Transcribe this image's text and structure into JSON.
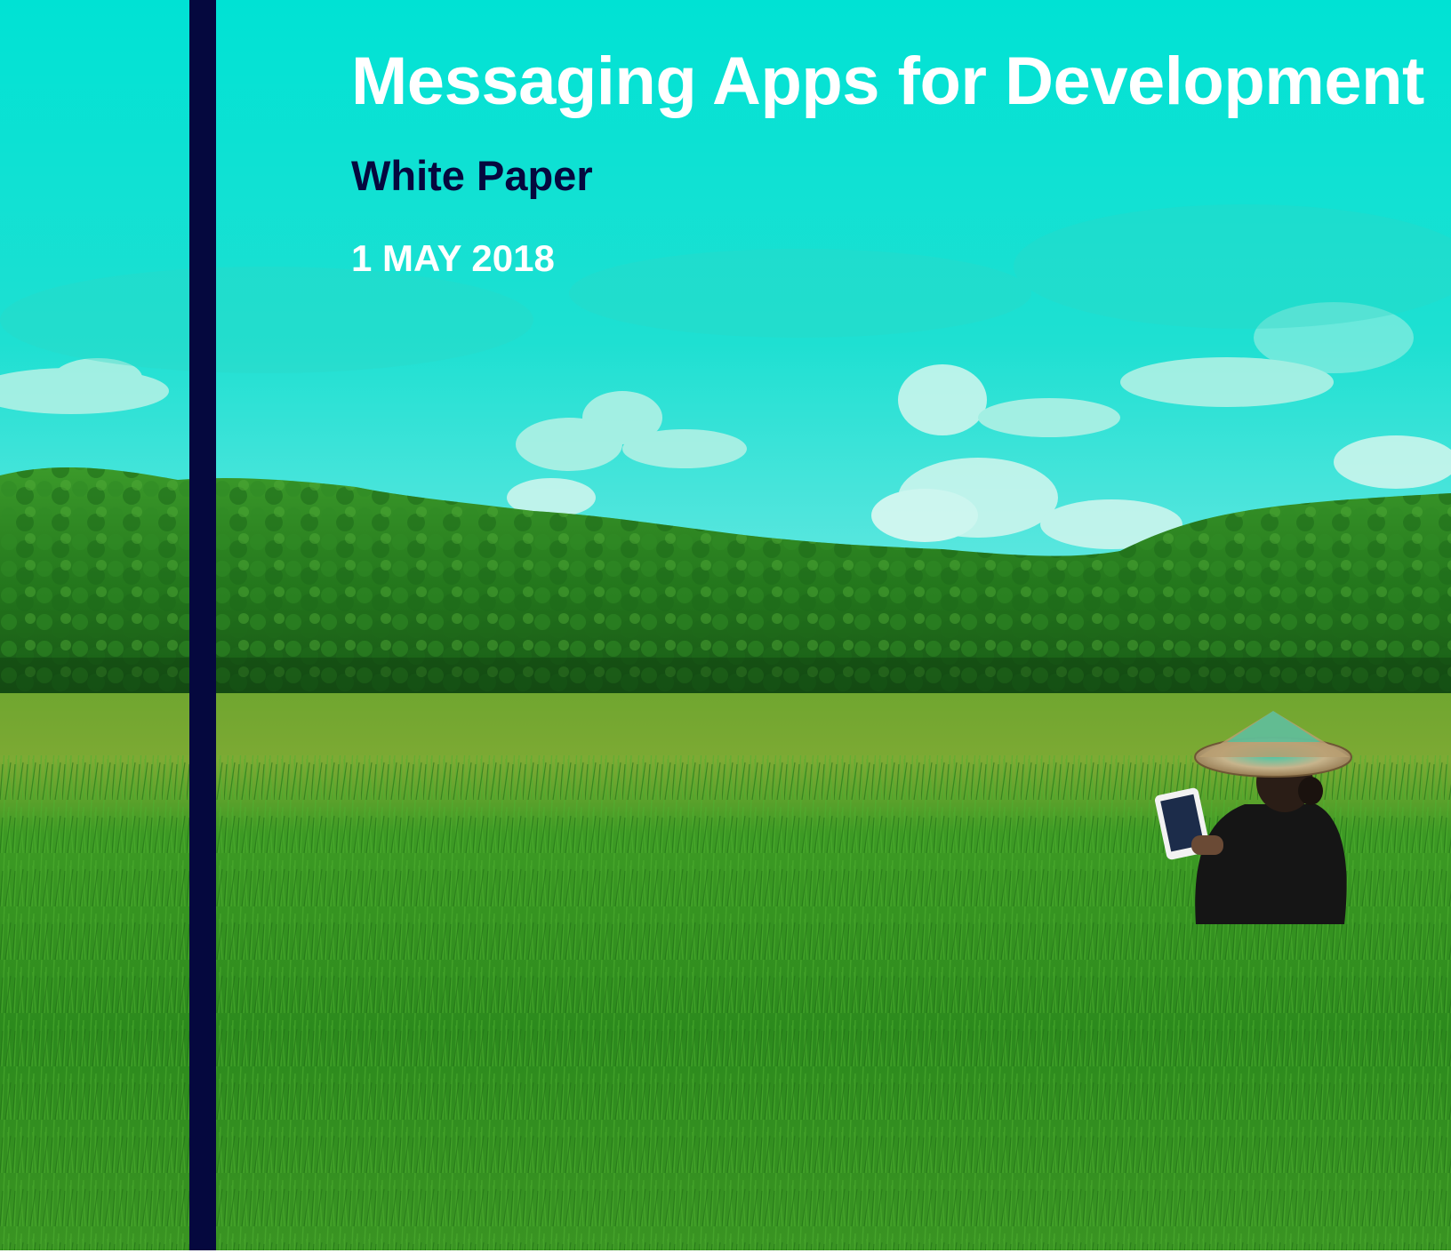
{
  "cover": {
    "title": "Messaging Apps for Development",
    "subtitle": "White Paper",
    "date": "1 MAY 2018"
  },
  "colors": {
    "sky_top": "#00e0d2",
    "sky_bottom": "#4fe6e0",
    "cloud": "#d8f7ef",
    "forest_dark": "#1f6a1a",
    "forest_light": "#3f9e2c",
    "field_far": "#5e9f2a",
    "field_near": "#2f8a1e",
    "navy_bar": "#05083e",
    "title_text": "#ffffff",
    "subtitle_text": "#05083e"
  }
}
